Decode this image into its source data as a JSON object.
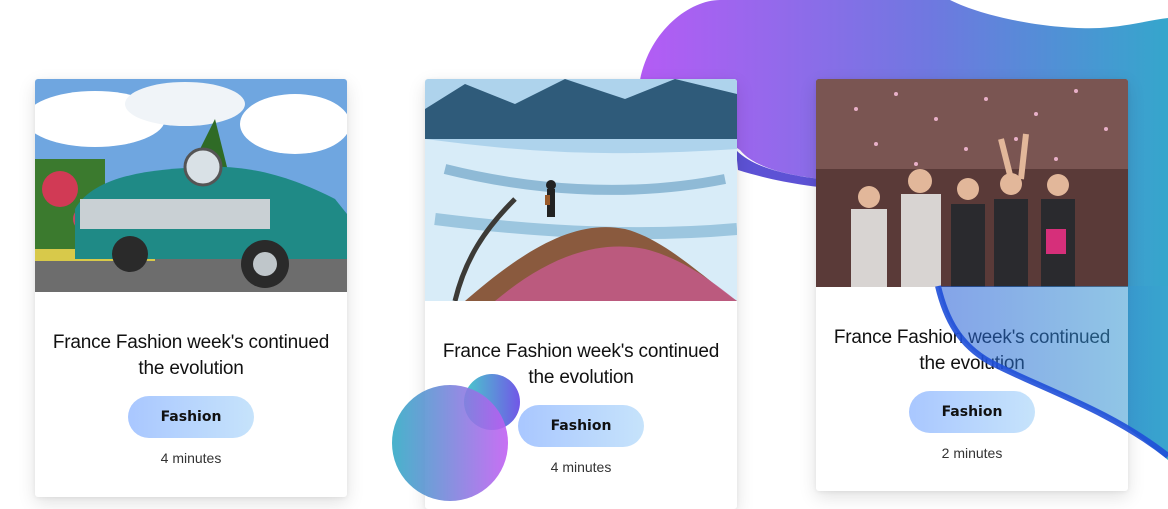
{
  "cards": [
    {
      "title": "France Fashion week's continued the evolution",
      "tag": "Fashion",
      "read_time": "4 minutes",
      "image": "vintage-car-photo"
    },
    {
      "title": "France Fashion week's continued the evolution",
      "tag": "Fashion",
      "read_time": "4 minutes",
      "image": "glacier-hiker-photo"
    },
    {
      "title": "France Fashion week's continued the evolution",
      "tag": "Fashion",
      "read_time": "2 minutes",
      "image": "party-confetti-photo"
    }
  ],
  "colors": {
    "blob_purple": "#b45cf5",
    "blob_blue": "#3aa0d0",
    "tag_gradient_start": "#a9c7ff",
    "tag_gradient_end": "#c6e3fb"
  }
}
